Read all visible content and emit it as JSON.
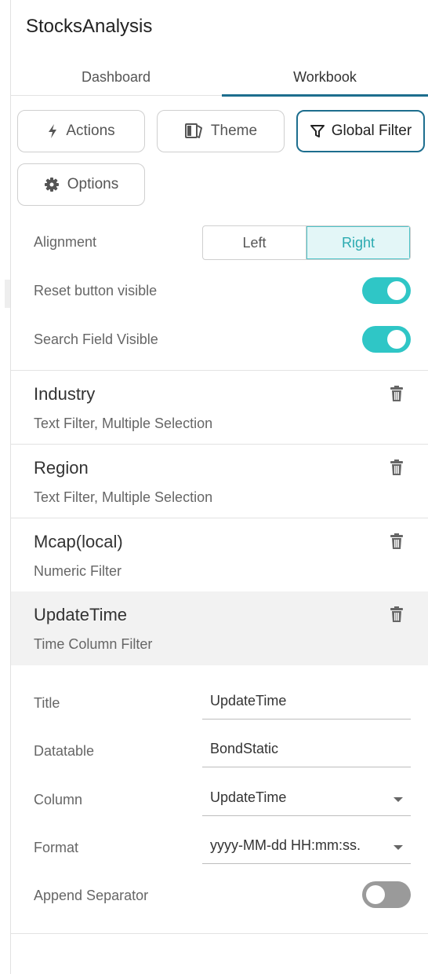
{
  "app": {
    "title": "StocksAnalysis"
  },
  "tabs": [
    {
      "label": "Dashboard",
      "active": false
    },
    {
      "label": "Workbook",
      "active": true
    }
  ],
  "buttons": {
    "actions": {
      "label": "Actions",
      "icon": "lightning-icon"
    },
    "theme": {
      "label": "Theme",
      "icon": "theme-icon"
    },
    "global_filter": {
      "label": "Global Filter",
      "icon": "filter-icon",
      "active": true
    },
    "options": {
      "label": "Options",
      "icon": "gear-icon"
    }
  },
  "alignment": {
    "label": "Alignment",
    "options": [
      "Left",
      "Right"
    ],
    "selected": "Right"
  },
  "settings": {
    "reset_button": {
      "label": "Reset button visible",
      "on": true
    },
    "search_field": {
      "label": "Search Field Visible",
      "on": true
    }
  },
  "filters": [
    {
      "name": "Industry",
      "description": "Text Filter, Multiple Selection",
      "selected": false
    },
    {
      "name": "Region",
      "description": "Text Filter, Multiple Selection",
      "selected": false
    },
    {
      "name": "Mcap(local)",
      "description": "Numeric Filter",
      "selected": false
    },
    {
      "name": "UpdateTime",
      "description": "Time Column Filter",
      "selected": true
    }
  ],
  "properties": {
    "title": {
      "label": "Title",
      "value": "UpdateTime"
    },
    "datatable": {
      "label": "Datatable",
      "value": "BondStatic"
    },
    "column": {
      "label": "Column",
      "value": "UpdateTime"
    },
    "format": {
      "label": "Format",
      "value": "yyyy-MM-dd HH:mm:ss."
    },
    "append_separator": {
      "label": "Append Separator",
      "on": false
    }
  },
  "colors": {
    "accent": "#1d6e8e",
    "toggle_on": "#2fc6c6",
    "toggle_off": "#9a9a9a",
    "segment_active_bg": "#e3f6f7",
    "segment_active_text": "#2aaab0",
    "selected_row_bg": "#f2f2f2"
  }
}
